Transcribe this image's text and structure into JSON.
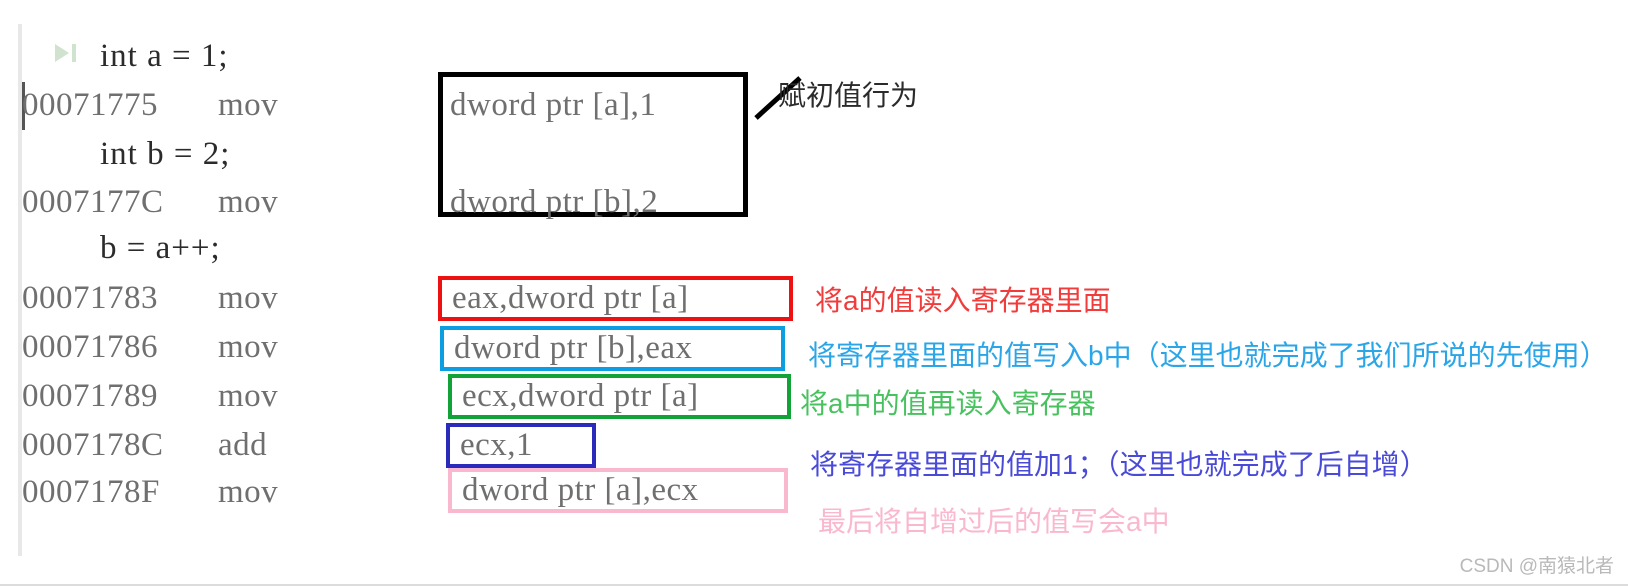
{
  "editor": {
    "caret_visible": true,
    "lines": [
      {
        "kind": "source",
        "text": "int a = 1;",
        "has_step_icon": true
      },
      {
        "kind": "asm",
        "address": "00071775",
        "mnemonic": "mov"
      },
      {
        "kind": "source",
        "text": "int b = 2;",
        "has_step_icon": false
      },
      {
        "kind": "asm",
        "address": "0007177C",
        "mnemonic": "mov"
      },
      {
        "kind": "source",
        "text": "b = a++;",
        "has_step_icon": false
      },
      {
        "kind": "asm",
        "address": "00071783",
        "mnemonic": "mov"
      },
      {
        "kind": "asm",
        "address": "00071786",
        "mnemonic": "mov"
      },
      {
        "kind": "asm",
        "address": "00071789",
        "mnemonic": "mov"
      },
      {
        "kind": "asm",
        "address": "0007178C",
        "mnemonic": "add"
      },
      {
        "kind": "asm",
        "address": "0007178F",
        "mnemonic": "mov"
      }
    ]
  },
  "operands": {
    "init_a": "dword ptr [a],1",
    "init_b": "dword ptr [b],2",
    "read_a_eax": "eax,dword ptr [a]",
    "write_b_eax": "dword ptr [b],eax",
    "read_a_ecx": "ecx,dword ptr [a]",
    "add_ecx_1": "ecx,1",
    "write_a_ecx": "dword ptr [a],ecx"
  },
  "annotations": {
    "init": "赋初值行为",
    "read_a": "将a的值读入寄存器里面",
    "write_b": "将寄存器里面的值写入b中（这里也就完成了我们所说的先使用）",
    "read_a_again": "将a中的值再读入寄存器",
    "increment": "将寄存器里面的值加1；（这里也就完成了后自增）",
    "write_back": "最后将自增过后的值写会a中"
  },
  "colors": {
    "box_init": "#000000",
    "box_read_a": "#ee1111",
    "box_write_b": "#0c9ee0",
    "box_read_a_again": "#12a338",
    "box_increment": "#2b2bbb",
    "box_write_back": "#f9b8cd",
    "anno_init": "#2b2b2b",
    "anno_read_a": "#f23b3b",
    "anno_write_b": "#2aa6e8",
    "anno_read_a_again": "#48c25f",
    "anno_increment": "#4a4ad8",
    "anno_write_back": "#fab8ce"
  },
  "watermark": "CSDN @南猿北者"
}
